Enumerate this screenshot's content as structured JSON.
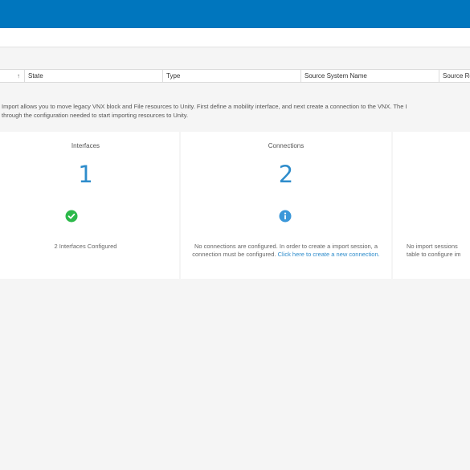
{
  "table": {
    "sort_glyph": "↑",
    "columns": [
      "State",
      "Type",
      "Source System Name",
      "Source Re"
    ]
  },
  "intro": {
    "line1": "Import allows you to move legacy VNX block and File resources to Unity. First define a mobility interface, and next create a connection to the VNX. The I",
    "line2": "through the configuration needed to start importing resources to Unity."
  },
  "cards": {
    "interfaces": {
      "title": "Interfaces",
      "count": "1",
      "status_icon": "check-circle-icon",
      "status_color": "#2cb94a",
      "description": "2 Interfaces Configured"
    },
    "connections": {
      "title": "Connections",
      "count": "2",
      "status_icon": "info-circle-icon",
      "status_color": "#3b97d9",
      "description_prefix": "No connections are configured. In order to create a import session, a connection must be configured. ",
      "link_text": "Click here to create a new connection."
    },
    "sessions": {
      "line1": "No import sessions",
      "line2": "table to configure im"
    }
  },
  "colors": {
    "header_blue": "#0076be",
    "accent_blue": "#2e8ccb"
  }
}
